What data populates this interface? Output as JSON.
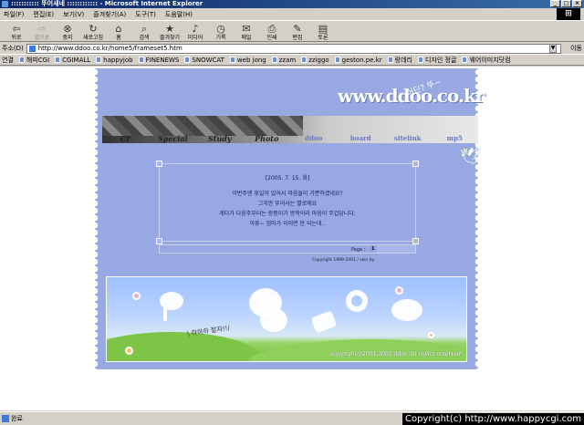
{
  "window": {
    "title": "::::::::::: 뚜어새네 :::::::::::: - Microsoft Internet Explorer",
    "buttons": [
      "_",
      "□",
      "×"
    ]
  },
  "menu": [
    "파일(F)",
    "편집(E)",
    "보기(V)",
    "즐겨찾기(A)",
    "도구(T)",
    "도움말(H)"
  ],
  "toolbar": [
    {
      "label": "뒤로",
      "icon": "back-arrow-icon",
      "glyph": "⇦",
      "enabled": true
    },
    {
      "label": "앞으로",
      "icon": "forward-arrow-icon",
      "glyph": "⇨",
      "enabled": false
    },
    {
      "label": "중지",
      "icon": "stop-icon",
      "glyph": "⊗",
      "enabled": true
    },
    {
      "label": "새로고침",
      "icon": "refresh-icon",
      "glyph": "↻",
      "enabled": true
    },
    {
      "label": "홈",
      "icon": "home-icon",
      "glyph": "⌂",
      "enabled": true
    },
    {
      "label": "검색",
      "icon": "search-icon",
      "glyph": "⌕",
      "enabled": true
    },
    {
      "label": "즐겨찾기",
      "icon": "favorites-icon",
      "glyph": "★",
      "enabled": true
    },
    {
      "label": "미디어",
      "icon": "media-icon",
      "glyph": "♪",
      "enabled": true
    },
    {
      "label": "기록",
      "icon": "history-icon",
      "glyph": "◷",
      "enabled": true
    },
    {
      "label": "메일",
      "icon": "mail-icon",
      "glyph": "✉",
      "enabled": true
    },
    {
      "label": "인쇄",
      "icon": "print-icon",
      "glyph": "⎙",
      "enabled": true
    },
    {
      "label": "편집",
      "icon": "edit-icon",
      "glyph": "✎",
      "enabled": true
    },
    {
      "label": "토론",
      "icon": "discuss-icon",
      "glyph": "▤",
      "enabled": true
    }
  ],
  "address": {
    "label": "주소(D)",
    "url": "http://www.ddoo.co.kr/home5/frameset5.htm",
    "go": "이동"
  },
  "links": {
    "label": "연결",
    "items": [
      "해피CGI",
      "CGIMALL",
      "happyjob",
      "FINENEWS",
      "SNOWCAT",
      "web jong",
      "zzam",
      "zziggo",
      "geston.pe.kr",
      "랑데리",
      "디자인 정글",
      "웨어이미지닷컴"
    ]
  },
  "page": {
    "logo": "www.ddoo.co.kr",
    "logo_sub": "어딘? 뚜~",
    "nav": [
      "CF",
      "Special",
      "Study",
      "Photo",
      "ddoo",
      "board",
      "sitelink",
      "mp5"
    ],
    "diary": {
      "date": "[2005. 7. 15. 화]",
      "lines": [
        "이번주엔 휴일이 있어서 마음들이 가뿐하겠네요?",
        "그치만 뚜어사는 별로에요",
        "게다가 다음주부터는 랑뚱이가 방학이라 마음이 무겁답니다.",
        "아휴~ 엄마가 이러면 안 되는데.."
      ]
    },
    "pager": {
      "label": "Page :",
      "current": "1"
    },
    "copyright": {
      "text": "Copyright 1999-2001",
      "skin_text": "/ skin by"
    },
    "scene": {
      "handwriting": "\\ 하하하 잘자!!/",
      "copyright": "copyright@2001-2002 ddoo All rights reserved"
    }
  },
  "status": {
    "text": "완료"
  },
  "watermark": "Copyright(c) http://www.happycgi.com"
}
